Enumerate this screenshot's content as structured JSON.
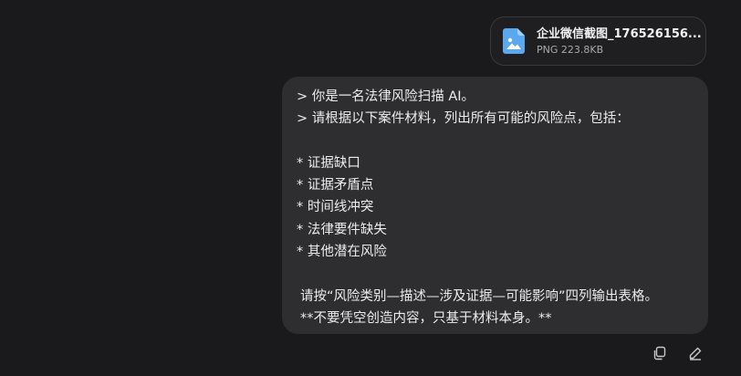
{
  "attachment": {
    "file_name": "企业微信截图_176526156...",
    "file_info": "PNG 223.8KB",
    "icon": "image-file-icon"
  },
  "message": {
    "lines": [
      "> 你是一名法律风险扫描 AI。",
      "> 请根据以下案件材料，列出所有可能的风险点，包括：",
      "",
      "* 证据缺口",
      "* 证据矛盾点",
      "* 时间线冲突",
      "* 法律要件缺失",
      "* 其他潜在风险",
      "",
      "请按“风险类别—描述—涉及证据—可能影响”四列输出表格。",
      "**不要凭空创造内容，只基于材料本身。**"
    ]
  },
  "actions": {
    "copy_icon": "copy-icon",
    "edit_icon": "edit-icon"
  },
  "colors": {
    "background": "#1a1a1c",
    "bubble": "#2e2e31",
    "attachment_border": "#3a3a3e",
    "icon_blue": "#5aa9f0"
  }
}
